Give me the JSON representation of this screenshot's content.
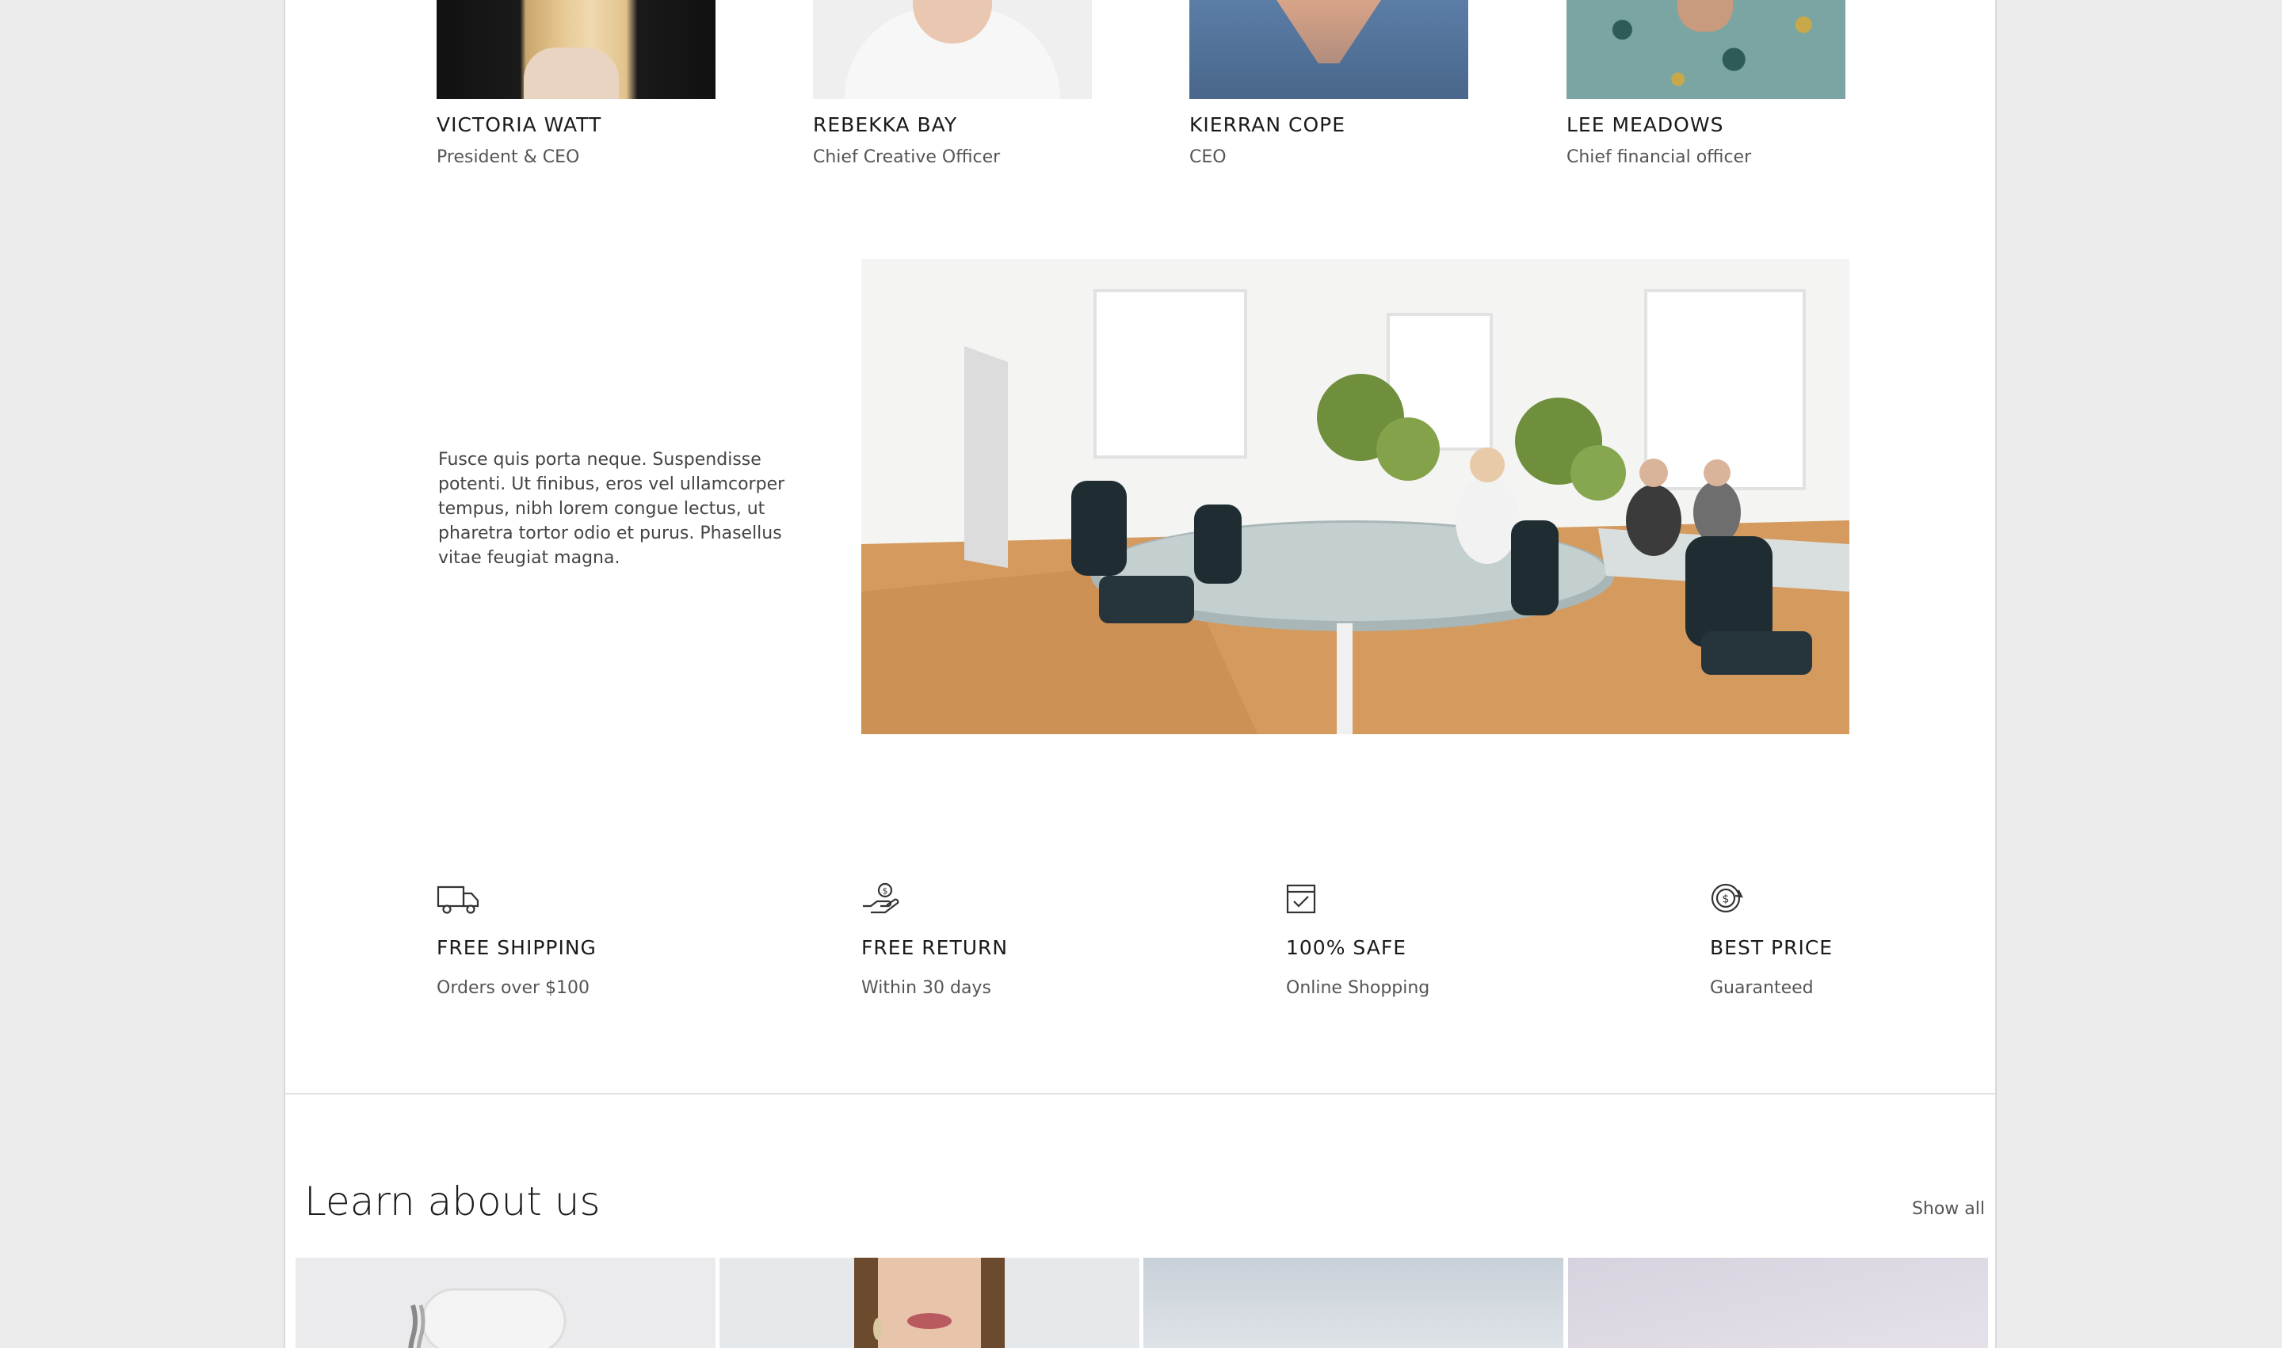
{
  "team": [
    {
      "name": "VICTORIA WATT",
      "role": "President & CEO"
    },
    {
      "name": "REBEKKA BAY",
      "role": "Chief Creative Officer"
    },
    {
      "name": "KIERRAN COPE",
      "role": "CEO"
    },
    {
      "name": "LEE MEADOWS",
      "role": "Chief financial officer"
    }
  ],
  "intro": {
    "text": "Fusce quis porta neque. Suspendisse potenti. Ut finibus, eros vel ullamcorper tempus, nibh lorem congue lectus, ut pharetra tortor odio et purus. Phasellus vitae feugiat magna."
  },
  "features": [
    {
      "icon": "truck-icon",
      "title": "FREE SHIPPING",
      "subtitle": "Orders over $100"
    },
    {
      "icon": "hand-coin-icon",
      "title": "FREE RETURN",
      "subtitle": "Within 30 days"
    },
    {
      "icon": "calendar-check-icon",
      "title": "100% SAFE",
      "subtitle": "Online Shopping"
    },
    {
      "icon": "dollar-cycle-icon",
      "title": "BEST PRICE",
      "subtitle": "Guaranteed"
    }
  ],
  "learn": {
    "title": "Learn about us",
    "show_all": "Show all"
  }
}
